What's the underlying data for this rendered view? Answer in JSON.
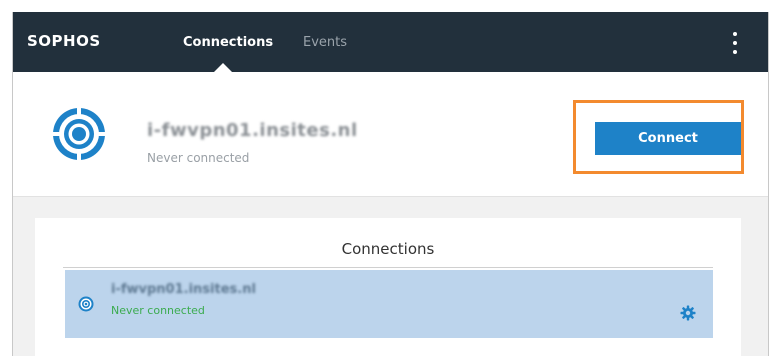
{
  "topbar": {
    "logo": "SOPHOS",
    "tabs": [
      {
        "label": "Connections",
        "active": true
      },
      {
        "label": "Events",
        "active": false
      }
    ],
    "menu_icon": "kebab-menu-icon"
  },
  "header": {
    "connection_name": "i-fwvpn01.insites.nl",
    "status": "Never connected",
    "connect_label": "Connect",
    "icon": "target-icon",
    "highlight_color": "#f38a2e"
  },
  "connections_panel": {
    "title": "Connections",
    "items": [
      {
        "name": "i-fwvpn01.insites.nl",
        "status": "Never connected",
        "icon": "target-icon",
        "settings_icon": "gear-icon"
      }
    ]
  },
  "colors": {
    "topbar_bg": "#22303c",
    "accent": "#1e82c8",
    "selected_row": "#bcd4ec",
    "status_green": "#3bab4f"
  }
}
